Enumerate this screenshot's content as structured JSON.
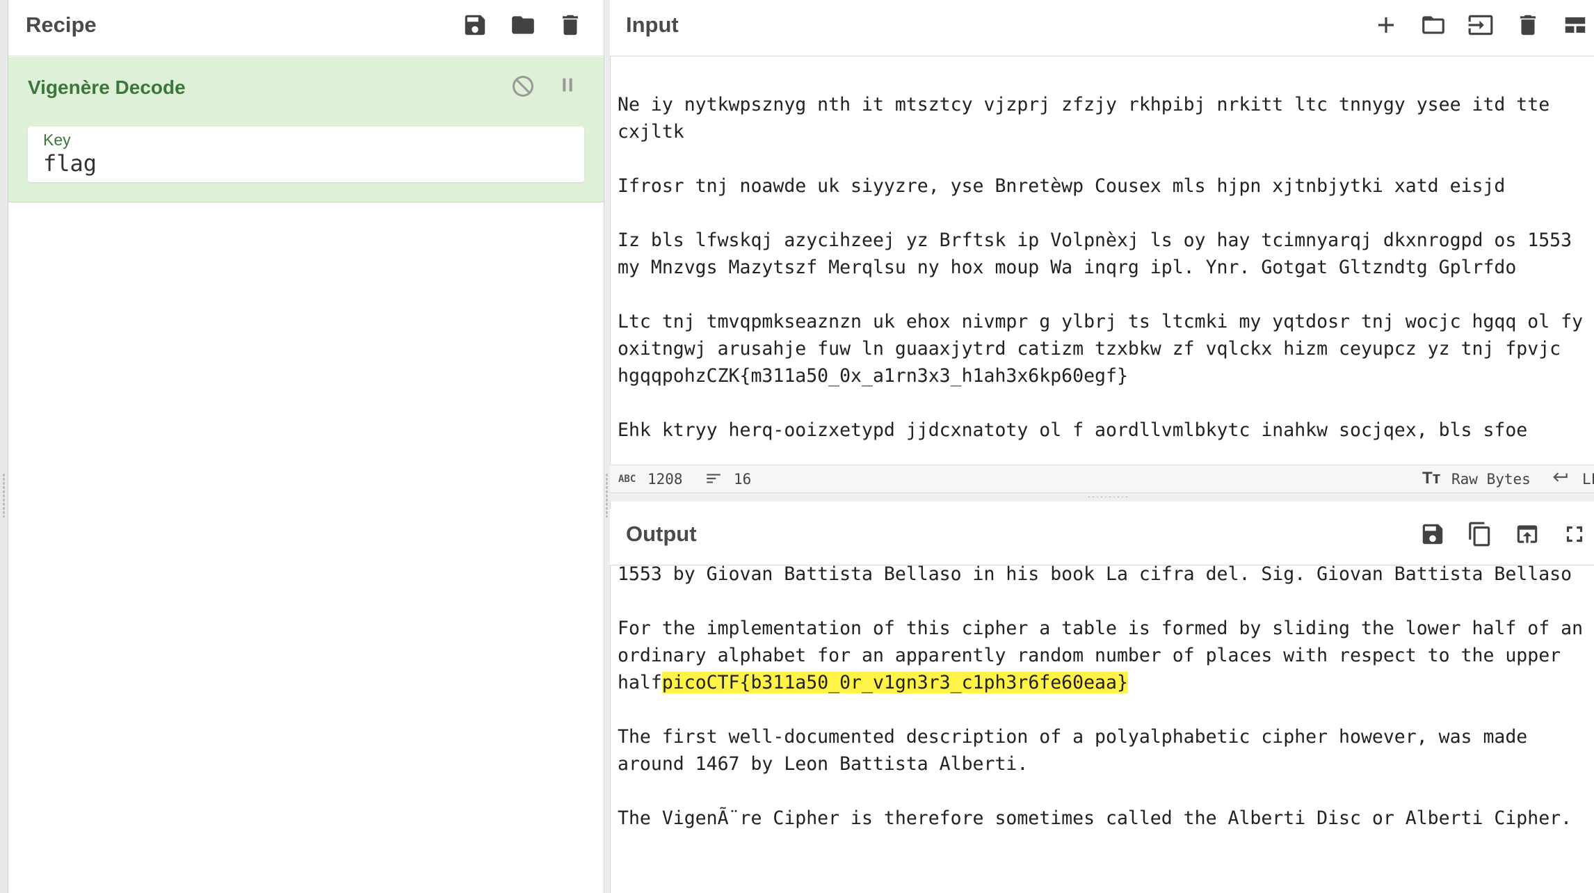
{
  "recipe": {
    "title": "Recipe",
    "operation": {
      "name": "Vigenère Decode",
      "key_label": "Key",
      "key_value": "flag"
    }
  },
  "input": {
    "title": "Input",
    "text": "\nNe iy nytkwpsznyg nth it mtsztcy vjzprj zfzjy rkhpibj nrkitt ltc tnnygy ysee itd tte cxjltk\n\nIfrosr tnj noawde uk siyyzre, yse Bnretèwp Cousex mls hjpn xjtnbjytki xatd eisjd\n\nIz bls lfwskqj azycihzeej yz Brftsk ip Volpnèxj ls oy hay tcimnyarqj dkxnrogpd os 1553 my Mnzvgs Mazytszf Merqlsu ny hox moup Wa inqrg ipl. Ynr. Gotgat Gltzndtg Gplrfdo\n\nLtc tnj tmvqpmkseaznzn uk ehox nivmpr g ylbrj ts ltcmki my yqtdosr tnj wocjc hgqq ol fy oxitngwj arusahje fuw ln guaaxjytrd catizm tzxbkw zf vqlckx hizm ceyupcz yz tnj fpvjc hgqqpohzCZK{m311a50_0x_a1rn3x3_h1ah3x6kp60egf}\n\nEhk ktryy herq-ooizxetypd jjdcxnatoty ol f aordllvmlbkytc inahkw socjqex, bls sfoe"
  },
  "status": {
    "length": "1208",
    "lines": "16",
    "raw_bytes": "Raw Bytes",
    "eol_partial": "LF"
  },
  "output": {
    "title": "Output",
    "text_before": "1553 by Giovan Battista Bellaso in his book La cifra del. Sig. Giovan Battista Bellaso\n\nFor the implementation of this cipher a table is formed by sliding the lower half of an ordinary alphabet for an apparently random number of places with respect to the upper half",
    "highlight": "picoCTF{b311a50_0r_v1gn3r3_c1ph3r6fe60eaa}",
    "text_after": "\n\nThe first well-documented description of a polyalphabetic cipher however, was made around 1467 by Leon Battista Alberti.\n\nThe VigenÃ¨re Cipher is therefore sometimes called the Alberti Disc or Alberti Cipher."
  },
  "colors": {
    "operation_bg": "#dff0d8",
    "operation_text": "#3c763d",
    "highlight": "#fff347"
  }
}
